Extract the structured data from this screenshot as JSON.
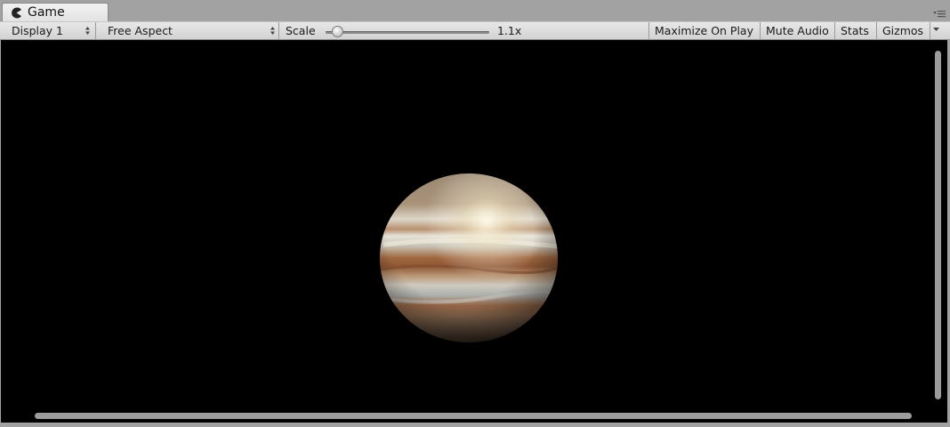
{
  "window": {
    "tab_title": "Game",
    "tab_icon": "pacman-icon"
  },
  "toolbar": {
    "display_label": "Display 1",
    "aspect_label": "Free Aspect",
    "scale_label": "Scale",
    "scale_value": "1.1x",
    "scale_slider_fraction": 0.04,
    "maximize_label": "Maximize On Play",
    "mute_label": "Mute Audio",
    "stats_label": "Stats",
    "gizmos_label": "Gizmos"
  },
  "viewport": {
    "background": "#000000",
    "object": "jupiter-planet"
  }
}
